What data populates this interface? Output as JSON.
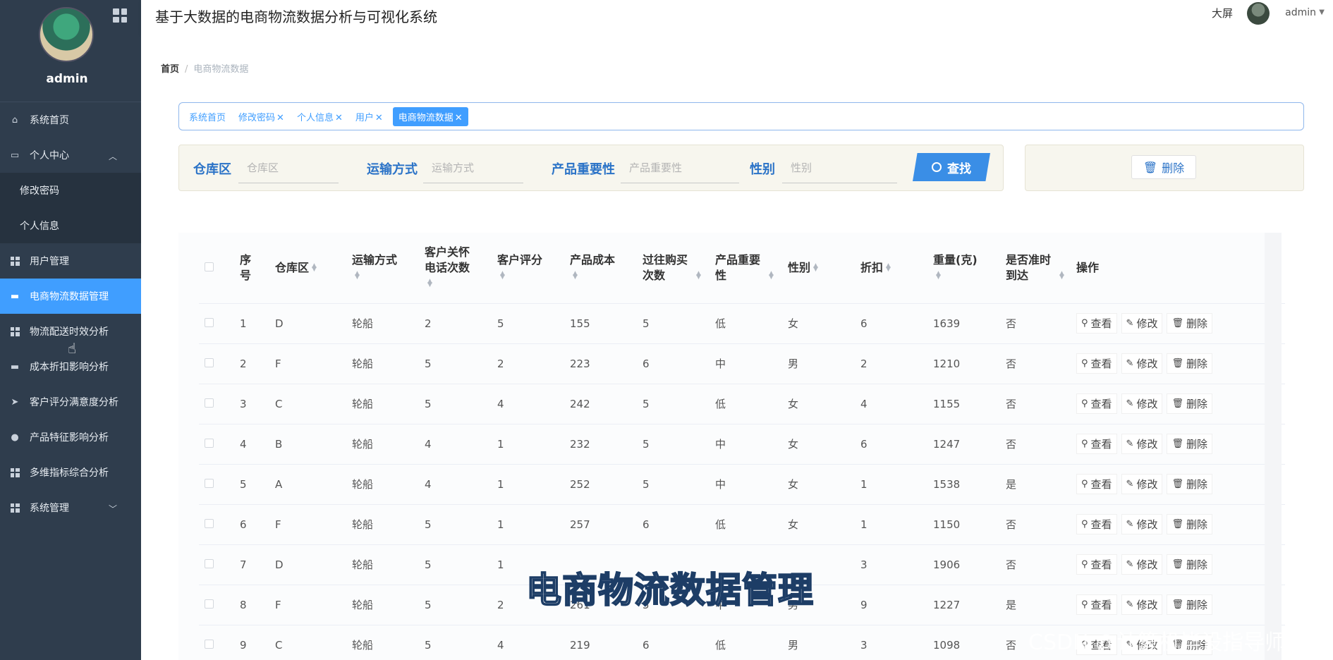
{
  "sidebar": {
    "username": "admin",
    "menu": [
      {
        "label": "系统首页",
        "icon": "home-icon"
      },
      {
        "label": "个人中心",
        "icon": "user-card-icon",
        "expanded": true
      },
      {
        "label": "修改密码",
        "sub": true
      },
      {
        "label": "个人信息",
        "sub": true
      },
      {
        "label": "用户管理",
        "icon": "grid-icon"
      },
      {
        "label": "电商物流数据管理",
        "icon": "monitor-icon",
        "active": true
      },
      {
        "label": "物流配送时效分析",
        "icon": "grid-icon"
      },
      {
        "label": "成本折扣影响分析",
        "icon": "monitor-icon"
      },
      {
        "label": "客户评分满意度分析",
        "icon": "send-icon"
      },
      {
        "label": "产品特征影响分析",
        "icon": "bulb-icon"
      },
      {
        "label": "多维指标综合分析",
        "icon": "grid-icon"
      },
      {
        "label": "系统管理",
        "icon": "grid-icon",
        "collapsed": true
      }
    ]
  },
  "header": {
    "title": "基于大数据的电商物流数据分析与可视化系统",
    "bigscreen": "大屏",
    "user": "admin"
  },
  "breadcrumb": {
    "home": "首页",
    "current": "电商物流数据"
  },
  "tabs": [
    "系统首页",
    "修改密码",
    "个人信息",
    "用户",
    "电商物流数据"
  ],
  "search": {
    "fields": [
      {
        "label": "仓库区",
        "placeholder": "仓库区"
      },
      {
        "label": "运输方式",
        "placeholder": "运输方式"
      },
      {
        "label": "产品重要性",
        "placeholder": "产品重要性"
      },
      {
        "label": "性别",
        "placeholder": "性别"
      }
    ],
    "find_label": "查找",
    "delete_label": "删除"
  },
  "table": {
    "columns": [
      "序号",
      "仓库区",
      "运输方式",
      "客户关怀电话次数",
      "客户评分",
      "产品成本",
      "过往购买次数",
      "产品重要性",
      "性别",
      "折扣",
      "重量(克)",
      "是否准时到达",
      "操作"
    ],
    "actions": [
      "查看",
      "修改",
      "删除"
    ],
    "rows": [
      [
        "1",
        "D",
        "轮船",
        "2",
        "5",
        "155",
        "5",
        "低",
        "女",
        "6",
        "1639",
        "否"
      ],
      [
        "2",
        "F",
        "轮船",
        "5",
        "2",
        "223",
        "6",
        "中",
        "男",
        "2",
        "1210",
        "否"
      ],
      [
        "3",
        "C",
        "轮船",
        "5",
        "4",
        "242",
        "5",
        "低",
        "女",
        "4",
        "1155",
        "否"
      ],
      [
        "4",
        "B",
        "轮船",
        "4",
        "1",
        "232",
        "5",
        "中",
        "女",
        "6",
        "1247",
        "否"
      ],
      [
        "5",
        "A",
        "轮船",
        "4",
        "1",
        "252",
        "5",
        "中",
        "女",
        "1",
        "1538",
        "是"
      ],
      [
        "6",
        "F",
        "轮船",
        "5",
        "1",
        "257",
        "6",
        "低",
        "女",
        "1",
        "1150",
        "否"
      ],
      [
        "7",
        "D",
        "轮船",
        "5",
        "1",
        "",
        "",
        "",
        "",
        "3",
        "1906",
        "否"
      ],
      [
        "8",
        "F",
        "轮船",
        "5",
        "2",
        "261",
        "5",
        "中",
        "男",
        "9",
        "1227",
        "是"
      ],
      [
        "9",
        "C",
        "轮船",
        "5",
        "4",
        "219",
        "6",
        "低",
        "男",
        "3",
        "1098",
        "否"
      ]
    ]
  },
  "overlay": {
    "subtitle": "电商物流数据管理",
    "watermark": "CSDN @计算机毕设指导师"
  }
}
